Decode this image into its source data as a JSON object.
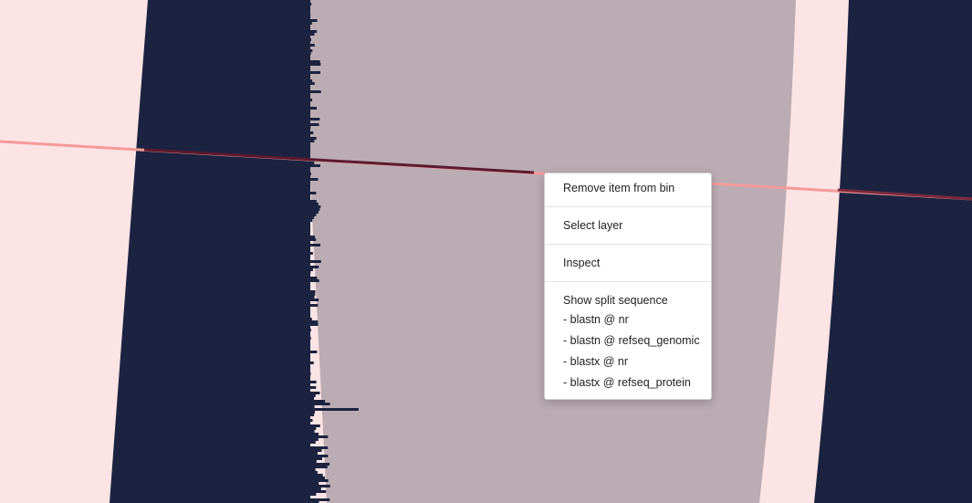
{
  "colors": {
    "background": "#fde4e4",
    "band_dark": "#1b2340",
    "band_mid": "#bbacb3",
    "selection_line": "#f59a9a",
    "selection_line_dark": "#5a1a2e"
  },
  "context_menu": {
    "remove_item": "Remove item from bin",
    "select_layer": "Select layer",
    "inspect": "Inspect",
    "show_split_sequence": "Show split sequence",
    "blast_options": [
      "- blastn @ nr",
      "- blastn @ refseq_genomic",
      "- blastx @ nr",
      "- blastx @ refseq_protein"
    ]
  }
}
